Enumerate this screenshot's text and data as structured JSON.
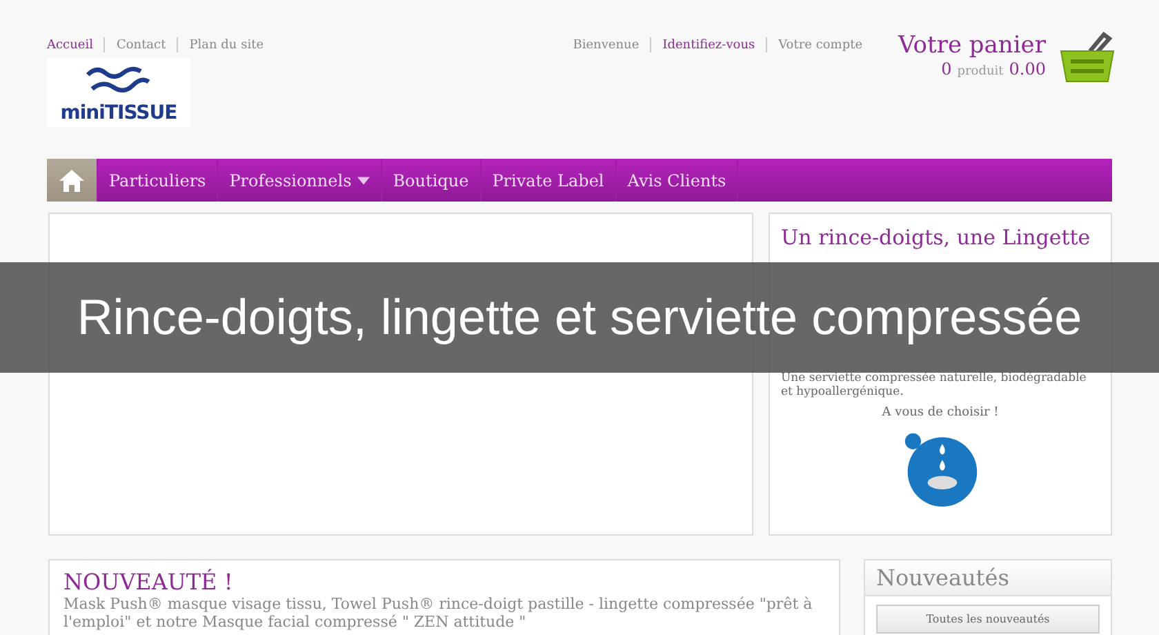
{
  "top_links": [
    {
      "label": "Accueil",
      "active": true
    },
    {
      "label": "Contact",
      "active": false
    },
    {
      "label": "Plan du site",
      "active": false
    }
  ],
  "logo": {
    "text": "miniTISSUE"
  },
  "account_links": [
    {
      "label": "Bienvenue",
      "active": false
    },
    {
      "label": "Identifiez-vous",
      "active": true
    },
    {
      "label": "Votre compte",
      "active": false
    }
  ],
  "cart": {
    "title": "Votre panier",
    "count": "0",
    "unit": "produit",
    "total": "0.00"
  },
  "nav": [
    {
      "kind": "home",
      "selected": true
    },
    {
      "kind": "link",
      "label": "Particuliers",
      "selected": false,
      "has_menu": false
    },
    {
      "kind": "link",
      "label": "Professionnels",
      "selected": false,
      "has_menu": true
    },
    {
      "kind": "link",
      "label": "Boutique",
      "selected": false,
      "has_menu": false
    },
    {
      "kind": "link",
      "label": "Private Label",
      "selected": false,
      "has_menu": false
    },
    {
      "kind": "link",
      "label": "Avis Clients",
      "selected": false,
      "has_menu": false
    }
  ],
  "promo": {
    "title": "Un rince-doigts, une Lingette",
    "paragraphs": [
      "Une serviette compressée naturelle, biodégradable et hypoallergénique."
    ],
    "cta": "A vous de choisir !"
  },
  "news": {
    "title": "NOUVEAUTÉ !",
    "text": "Mask Push® masque visage tissu, Towel Push® rince-doigt pastille - lingette compressée \"prêt à l'emploi\" et notre Masque facial compressé \" ZEN attitude \""
  },
  "sidebar": {
    "title": "Nouveautés",
    "button": "Toutes les nouveautés"
  },
  "banner": {
    "text": "Rince-doigts, lingette et serviette compressée"
  }
}
